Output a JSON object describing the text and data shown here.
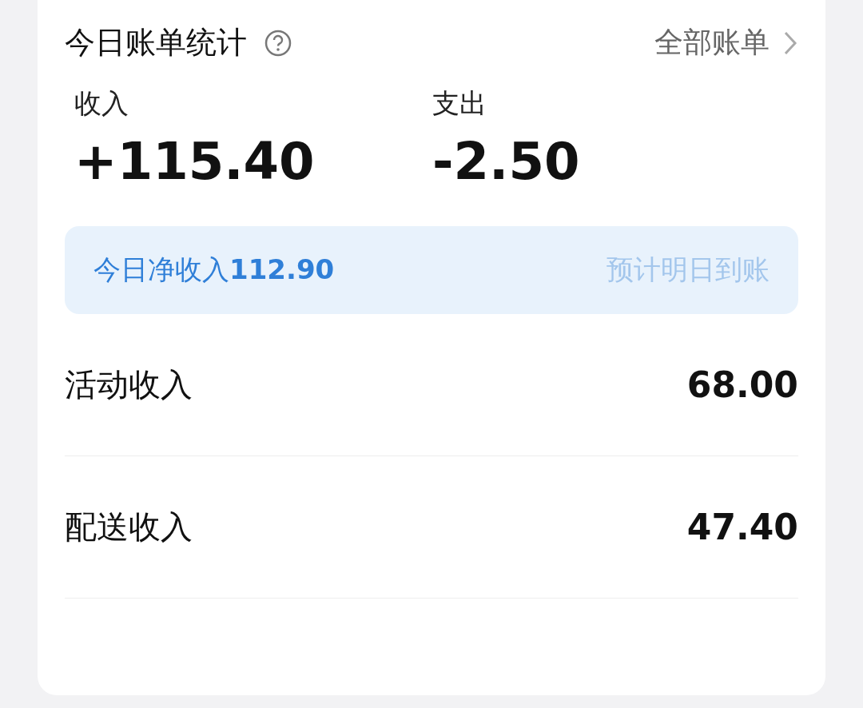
{
  "header": {
    "title": "今日账单统计",
    "link": "全部账单"
  },
  "summary": [
    {
      "label": "收入",
      "amount": "+115.40"
    },
    {
      "label": "支出",
      "amount": "-2.50"
    }
  ],
  "net": {
    "text": "今日净收入**112.90**",
    "note": "预计明日到账"
  },
  "rows": [
    {
      "label": "活动收入",
      "value": "68.00"
    },
    {
      "label": "配送收入",
      "value": "47.40"
    }
  ]
}
